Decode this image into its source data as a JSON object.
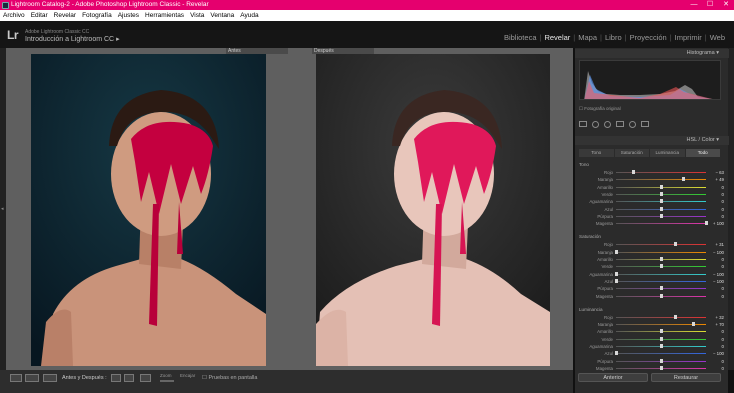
{
  "window": {
    "title": "Lightroom Catalog-2 - Adobe Photoshop Lightroom Classic - Revelar",
    "controls": [
      "—",
      "☐",
      "✕"
    ]
  },
  "menu": [
    "Archivo",
    "Editar",
    "Revelar",
    "Fotografía",
    "Ajustes",
    "Herramientas",
    "Vista",
    "Ventana",
    "Ayuda"
  ],
  "identity": {
    "logo": "Lr",
    "catalog": "Adobe Lightroom Classic CC",
    "title": "Introducción a Lightroom CC",
    "arrow": "▸"
  },
  "modules": [
    {
      "label": "Biblioteca",
      "active": false
    },
    {
      "label": "Revelar",
      "active": true
    },
    {
      "label": "Mapa",
      "active": false
    },
    {
      "label": "Libro",
      "active": false
    },
    {
      "label": "Proyección",
      "active": false
    },
    {
      "label": "Imprimir",
      "active": false
    },
    {
      "label": "Web",
      "active": false
    }
  ],
  "viewer": {
    "before_label": "Antes",
    "after_label": "Después"
  },
  "panel": {
    "histogram_label": "Histograma ▾",
    "original_label": "Fotografía original",
    "hsl_label": "HSL / Color ▾",
    "tabs": [
      {
        "label": "Tono",
        "on": false
      },
      {
        "label": "Saturación",
        "on": false
      },
      {
        "label": "Luminancia",
        "on": false
      },
      {
        "label": "Todo",
        "on": true
      }
    ],
    "groups": [
      {
        "title": "Tono",
        "rows": [
          {
            "label": "Rojo",
            "value": "− 63",
            "pos": -63,
            "color": "#d33"
          },
          {
            "label": "Naranja",
            "value": "+ 49",
            "pos": 49,
            "color": "#e80"
          },
          {
            "label": "Amarillo",
            "value": "0",
            "pos": 0,
            "color": "#dd3"
          },
          {
            "label": "Verde",
            "value": "0",
            "pos": 0,
            "color": "#3c3"
          },
          {
            "label": "Aguamarina",
            "value": "0",
            "pos": 0,
            "color": "#3cc"
          },
          {
            "label": "Azul",
            "value": "0",
            "pos": 0,
            "color": "#36d"
          },
          {
            "label": "Púrpura",
            "value": "0",
            "pos": 0,
            "color": "#93c"
          },
          {
            "label": "Magenta",
            "value": "+ 100",
            "pos": 100,
            "color": "#d3a"
          }
        ]
      },
      {
        "title": "Saturación",
        "rows": [
          {
            "label": "Rojo",
            "value": "+ 31",
            "pos": 31,
            "color": "#d33"
          },
          {
            "label": "Naranja",
            "value": "− 100",
            "pos": -100,
            "color": "#e80"
          },
          {
            "label": "Amarillo",
            "value": "0",
            "pos": 0,
            "color": "#dd3"
          },
          {
            "label": "Verde",
            "value": "0",
            "pos": 0,
            "color": "#3c3"
          },
          {
            "label": "Aguamarina",
            "value": "− 100",
            "pos": -100,
            "color": "#3cc"
          },
          {
            "label": "Azul",
            "value": "− 100",
            "pos": -100,
            "color": "#36d"
          },
          {
            "label": "Púrpura",
            "value": "0",
            "pos": 0,
            "color": "#93c"
          },
          {
            "label": "Magenta",
            "value": "0",
            "pos": 0,
            "color": "#d3a"
          }
        ]
      },
      {
        "title": "Luminancia",
        "rows": [
          {
            "label": "Rojo",
            "value": "+ 32",
            "pos": 32,
            "color": "#d33"
          },
          {
            "label": "Naranja",
            "value": "+ 70",
            "pos": 70,
            "color": "#e80"
          },
          {
            "label": "Amarillo",
            "value": "0",
            "pos": 0,
            "color": "#dd3"
          },
          {
            "label": "Verde",
            "value": "0",
            "pos": 0,
            "color": "#3c3"
          },
          {
            "label": "Aguamarina",
            "value": "0",
            "pos": 0,
            "color": "#3cc"
          },
          {
            "label": "Azul",
            "value": "− 100",
            "pos": -100,
            "color": "#36d"
          },
          {
            "label": "Púrpura",
            "value": "0",
            "pos": 0,
            "color": "#93c"
          },
          {
            "label": "Magenta",
            "value": "0",
            "pos": 0,
            "color": "#d3a"
          }
        ]
      }
    ],
    "prev_button": "Anterior",
    "reset_button": "Restaurar"
  },
  "toolbar": {
    "compare_label": "Antes y Después :",
    "zoom_label": "Zoom",
    "fit_label": "Encajar",
    "proof_label": "Pruebas en pantalla"
  }
}
